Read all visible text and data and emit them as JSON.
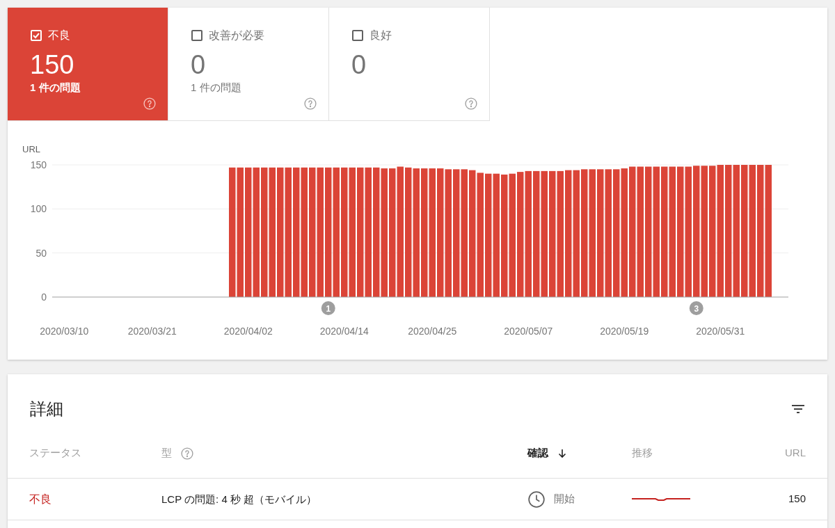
{
  "summary_tiles": [
    {
      "label": "不良",
      "checked": true,
      "selected": true,
      "count": "150",
      "issues": "1 件の問題"
    },
    {
      "label": "改善が必要",
      "checked": false,
      "selected": false,
      "count": "0",
      "issues": "1 件の問題"
    },
    {
      "label": "良好",
      "checked": false,
      "selected": false,
      "count": "0"
    }
  ],
  "chart_data": {
    "type": "bar",
    "ylabel": "URL",
    "ylim": [
      0,
      150
    ],
    "yticks": [
      0,
      50,
      100,
      150
    ],
    "categories": [
      null,
      "2020/03/10",
      null,
      null,
      null,
      null,
      null,
      null,
      null,
      null,
      null,
      null,
      "2020/03/21",
      null,
      null,
      null,
      null,
      null,
      null,
      null,
      null,
      null,
      null,
      null,
      "2020/04/02",
      null,
      null,
      null,
      null,
      null,
      null,
      null,
      null,
      null,
      null,
      null,
      "2020/04/14",
      null,
      null,
      null,
      null,
      null,
      null,
      null,
      null,
      null,
      null,
      "2020/04/25",
      null,
      null,
      null,
      null,
      null,
      null,
      null,
      null,
      null,
      null,
      null,
      "2020/05/07",
      null,
      null,
      null,
      null,
      null,
      null,
      null,
      null,
      null,
      null,
      null,
      "2020/05/19",
      null,
      null,
      null,
      null,
      null,
      null,
      null,
      null,
      null,
      null,
      null,
      "2020/05/31",
      null,
      null,
      null,
      null,
      null,
      null,
      null,
      null
    ],
    "series": [
      {
        "color": "#db4437",
        "values": [
          null,
          null,
          null,
          null,
          null,
          null,
          null,
          null,
          null,
          null,
          null,
          null,
          null,
          null,
          null,
          null,
          null,
          null,
          null,
          null,
          null,
          null,
          147,
          147,
          147,
          147,
          147,
          147,
          147,
          147,
          147,
          147,
          147,
          147,
          147,
          147,
          147,
          147,
          147,
          147,
          147,
          146,
          146,
          148,
          147,
          146,
          146,
          146,
          146,
          145,
          145,
          145,
          144,
          141,
          140,
          140,
          139,
          140,
          142,
          143,
          143,
          143,
          143,
          143,
          144,
          144,
          145,
          145,
          145,
          145,
          145,
          146,
          148,
          148,
          148,
          148,
          148,
          148,
          148,
          148,
          149,
          149,
          149,
          150,
          150,
          150,
          150,
          150,
          150,
          150,
          null,
          null
        ]
      }
    ],
    "annotations": [
      "1",
      "3"
    ]
  },
  "details": {
    "title": "詳細",
    "columns": [
      {
        "label": "ステータス",
        "help": false,
        "sorted": false
      },
      {
        "label": "型",
        "help": true,
        "sorted": false
      },
      {
        "label": "確認",
        "help": false,
        "sorted": true
      },
      {
        "label": "推移",
        "help": false,
        "sorted": false
      },
      {
        "label": "URL",
        "help": false,
        "sorted": false
      }
    ],
    "rows": [
      {
        "status": "不良",
        "color": "#c5221f",
        "type": "LCP の問題: 4 秒 超（モバイル）",
        "validation": "開始",
        "urls": "150"
      }
    ]
  }
}
